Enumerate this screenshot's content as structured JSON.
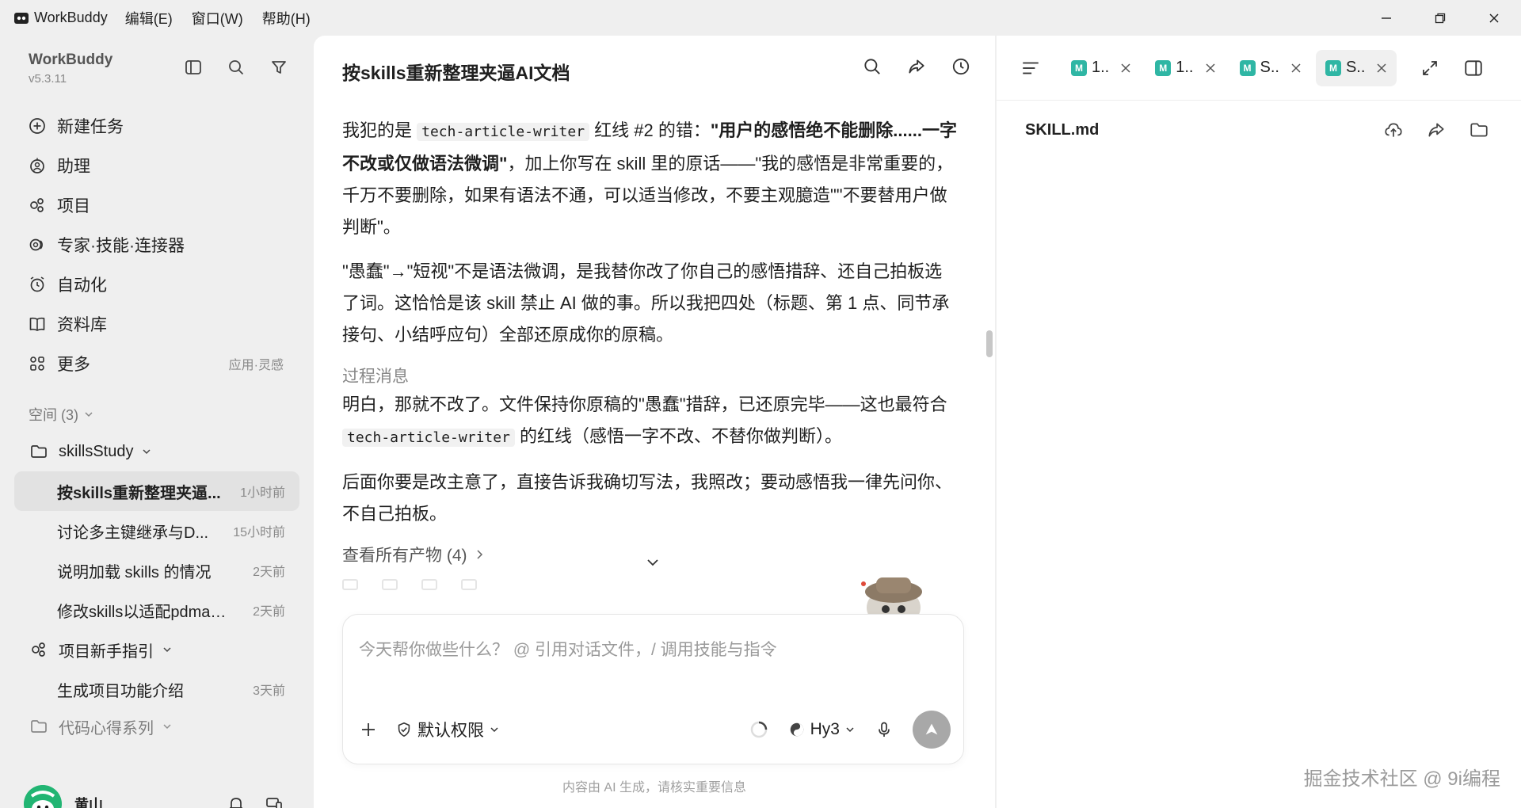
{
  "titlebar": {
    "app_name": "WorkBuddy",
    "menus": [
      "编辑(E)",
      "窗口(W)",
      "帮助(H)"
    ]
  },
  "sidebar": {
    "brand_name": "WorkBuddy",
    "version": "v5.3.11",
    "nav": [
      {
        "label": "新建任务",
        "icon": "plus-circle-icon"
      },
      {
        "label": "助理",
        "icon": "assistant-icon"
      },
      {
        "label": "项目",
        "icon": "project-icon"
      },
      {
        "label": "专家·技能·连接器",
        "icon": "experts-icon"
      },
      {
        "label": "自动化",
        "icon": "alarm-clock-icon"
      },
      {
        "label": "资料库",
        "icon": "book-icon"
      },
      {
        "label": "更多",
        "icon": "grid-icon",
        "extra": "应用·灵感"
      }
    ],
    "space_header": "空间 (3)",
    "folders": [
      {
        "name": "skillsStudy",
        "threads": [
          {
            "title": "按skills重新整理夹逼...",
            "time": "1小时前"
          },
          {
            "title": "讨论多主键继承与D...",
            "time": "15小时前"
          },
          {
            "title": "说明加载 skills 的情况",
            "time": "2天前"
          },
          {
            "title": "修改skills以适配pdman....",
            "time": "2天前"
          }
        ]
      },
      {
        "name": "项目新手指引",
        "threads": [
          {
            "title": "生成项目功能介绍",
            "time": "3天前"
          }
        ]
      },
      {
        "name": "代码心得系列",
        "threads": []
      }
    ],
    "user_name": "黄山"
  },
  "chat": {
    "title": "按skills重新整理夹逼AI文档",
    "p1": {
      "a": "我犯的是 ",
      "code": "tech-article-writer",
      "b": " 红线 #2 的错：",
      "bold": "\"用户的感悟绝不能删除......一字不改或仅做语法微调\"",
      "c": "，加上你写在 skill 里的原话——\"我的感悟是非常重要的，千万不要删除，如果有语法不通，可以适当修改，不要主观臆造\"\"不要替用户做判断\"。"
    },
    "p2": "\"愚蠢\"→\"短视\"不是语法微调，是我替你改了你自己的感悟措辞、还自己拍板选了词。这恰恰是该 skill 禁止 AI 做的事。所以我把四处（标题、第 1 点、同节承接句、小结呼应句）全部还原成你的原稿。",
    "section_label": "过程消息",
    "p3": {
      "a": "明白，那就不改了。文件保持你原稿的\"愚蠢\"措辞，已还原完毕——这也最符合 ",
      "code": "tech-article-writer",
      "b": " 的红线（感悟一字不改、不替你做判断）。"
    },
    "p4": "后面你要是改主意了，直接告诉我确切写法，我照改；要动感悟我一律先问你、不自己拍板。",
    "artifacts": "查看所有产物 (4)",
    "composer_placeholder": "今天帮你做些什么？ @ 引用对话文件，/ 调用技能与指令",
    "permission": "默认权限",
    "model": "Hy3",
    "disclaimer": "内容由 AI 生成，请核实重要信息"
  },
  "filepanel": {
    "tabs": [
      {
        "name": "1..",
        "active": false
      },
      {
        "name": "1..",
        "active": false
      },
      {
        "name": "S..",
        "active": false
      },
      {
        "name": "S..",
        "active": true
      }
    ],
    "tab_icon_letter": "M",
    "file_name": "SKILL.md",
    "watermark": "掘金技术社区 @ 9i编程"
  },
  "colors": {
    "accent_teal": "#2fb6a4",
    "avatar_green": "#22b573",
    "send_disabled": "#a8a8a8"
  }
}
